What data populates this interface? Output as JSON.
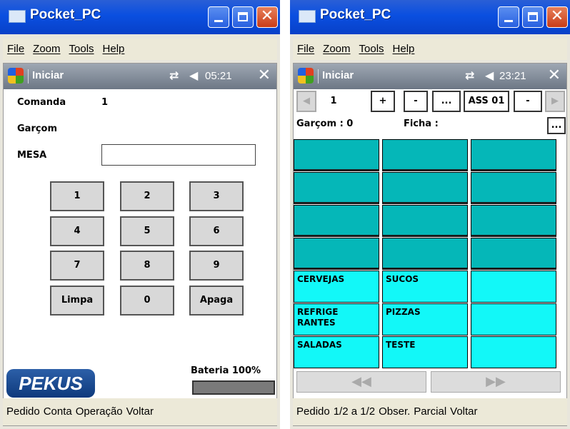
{
  "win1": {
    "title": "Pocket_PC",
    "menu": [
      "File",
      "Zoom",
      "Tools",
      "Help"
    ],
    "start_label": "Iniciar",
    "clock": "05:21",
    "comanda_label": "Comanda",
    "comanda_value": "1",
    "garcom_label": "Garçom",
    "mesa_label": "MESA",
    "mesa_value": "",
    "keys": [
      "1",
      "2",
      "3",
      "4",
      "5",
      "6",
      "7",
      "8",
      "9",
      "Limpa",
      "0",
      "Apaga"
    ],
    "logo": "PEKUS",
    "battery_label": "Bateria 100%",
    "battery_level": 1.0,
    "softkeys": [
      "Pedido",
      "Conta",
      "Operação",
      "Voltar"
    ]
  },
  "win2": {
    "title": "Pocket_PC",
    "menu": [
      "File",
      "Zoom",
      "Tools",
      "Help"
    ],
    "start_label": "Iniciar",
    "clock": "23:21",
    "nav": {
      "number": "1",
      "plus": "+",
      "minus": "-",
      "dots": "...",
      "ass": "ASS 01",
      "minus2": "-"
    },
    "garcom_label": "Garçom : 0",
    "ficha_label": "Ficha :",
    "ficha_button": "...",
    "categories": [
      "CERVEJAS",
      "SUCOS",
      "",
      "REFRIGE RANTES",
      "PIZZAS",
      "",
      "SALADAS",
      "TESTE",
      ""
    ],
    "softkeys": [
      "Pedido",
      "1/2 a 1/2",
      "Obser.",
      "Parcial",
      "Voltar"
    ]
  },
  "colors": {
    "title_blue": "#0a4fe0",
    "teal_dark": "#05b7b8",
    "cyan": "#12f8f8"
  }
}
